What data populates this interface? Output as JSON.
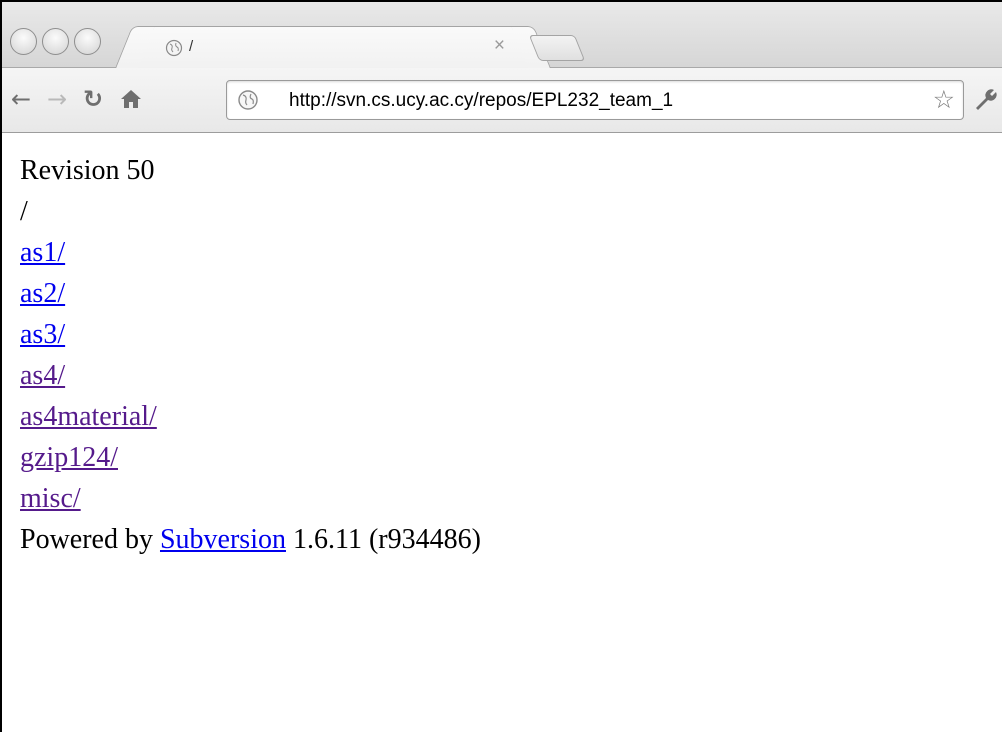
{
  "tab": {
    "title": "/",
    "close": "×"
  },
  "toolbar": {
    "back_icon": "back-arrow-icon",
    "forward_icon": "forward-arrow-icon",
    "reload_icon": "reload-icon",
    "home_icon": "home-icon",
    "url": "http://svn.cs.ucy.ac.cy/repos/EPL232_team_1",
    "star_icon": "bookmark-star-icon",
    "wrench_icon": "wrench-icon"
  },
  "page": {
    "revision": "Revision 50",
    "path": "/",
    "entries": [
      {
        "label": "as1/",
        "visited": false
      },
      {
        "label": "as2/",
        "visited": false
      },
      {
        "label": "as3/",
        "visited": false
      },
      {
        "label": "as4/",
        "visited": true
      },
      {
        "label": "as4material/",
        "visited": true
      },
      {
        "label": "gzip124/",
        "visited": true
      },
      {
        "label": "misc/",
        "visited": true
      }
    ],
    "footer": {
      "prefix": "Powered by ",
      "link": "Subversion",
      "suffix": " 1.6.11 (r934486)"
    }
  },
  "colors": {
    "link": "#0000ee",
    "visited": "#551a8b"
  }
}
